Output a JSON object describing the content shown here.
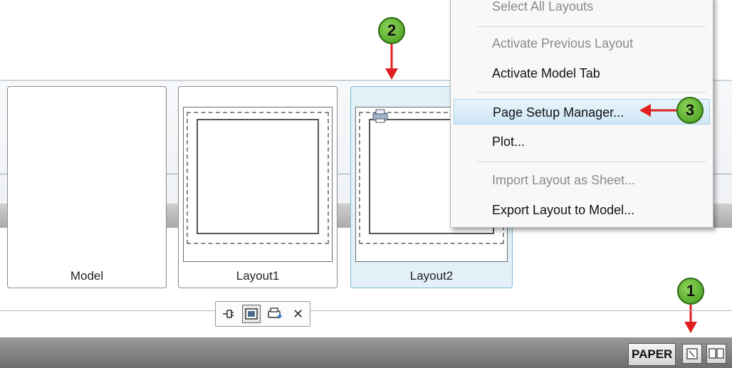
{
  "thumbnails": [
    {
      "label": "Model"
    },
    {
      "label": "Layout1"
    },
    {
      "label": "Layout2"
    }
  ],
  "context_menu": {
    "items": [
      {
        "label": "Select All Layouts",
        "disabled": true
      },
      {
        "label": "Activate Previous Layout",
        "disabled": true
      },
      {
        "label": "Activate Model Tab",
        "disabled": false
      },
      {
        "label": "Page Setup Manager...",
        "disabled": false,
        "highlighted": true
      },
      {
        "label": "Plot...",
        "disabled": false
      },
      {
        "label": "Import Layout as Sheet...",
        "disabled": true
      },
      {
        "label": "Export Layout to Model...",
        "disabled": false
      }
    ]
  },
  "callouts": [
    "1",
    "2",
    "3"
  ],
  "mini_toolbar": {
    "icons": [
      "pin-icon",
      "layout-view-icon",
      "plot-icon",
      "close-icon"
    ],
    "close_glyph": "✕"
  },
  "status_bar": {
    "paper_label": "PAPER"
  },
  "colors": {
    "callout_green": "#4caf25",
    "arrow_red": "#e02020",
    "selected_tab": "#e3f0f7"
  }
}
